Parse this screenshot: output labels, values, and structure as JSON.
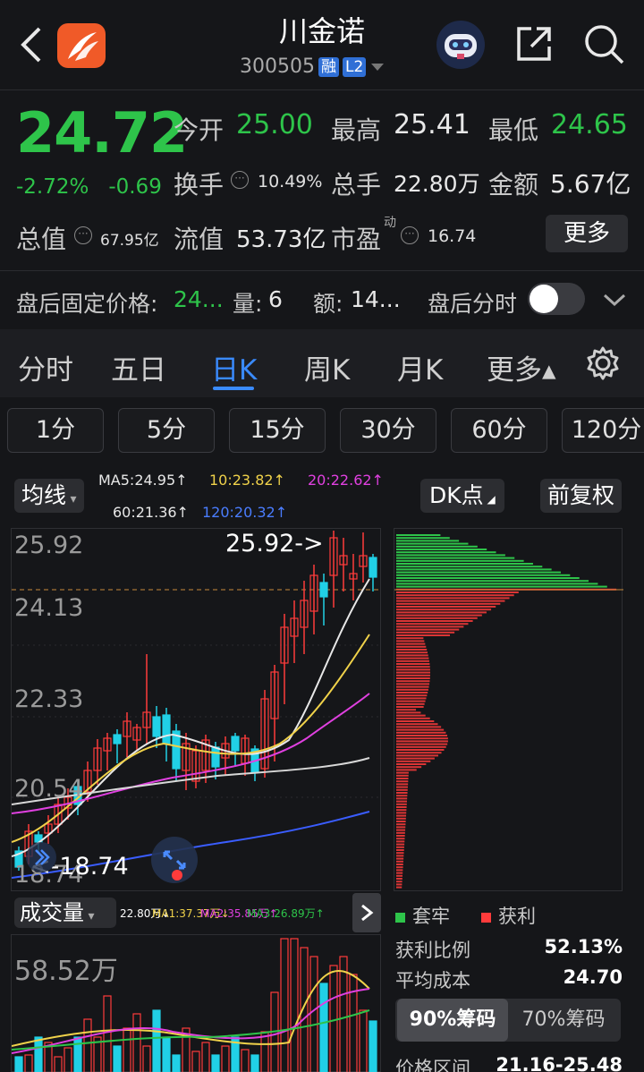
{
  "header": {
    "title": "川金诺",
    "code": "300505",
    "tag_margin": "融",
    "tag_level": "L2"
  },
  "quote": {
    "price": "24.72",
    "change_pct": "-2.72%",
    "change_amt": "-0.69",
    "open_label": "今开",
    "open": "25.00",
    "high_label": "最高",
    "high": "25.41",
    "low_label": "最低",
    "low": "24.65",
    "turnover_label": "换手",
    "turnover": "10.49%",
    "volume_label": "总手",
    "volume": "22.80万",
    "amount_label": "金额",
    "amount": "5.67亿",
    "mktcap_label": "总值",
    "mktcap": "67.95亿",
    "float_label": "流值",
    "float": "53.73亿",
    "pe_label": "市盈",
    "pe_sup": "动",
    "pe": "16.74",
    "more_label": "更多"
  },
  "after_hours": {
    "price_label": "盘后固定价格:",
    "price": "24...",
    "vol_label": "量:",
    "vol": "6",
    "amt_label": "额:",
    "amt": "14...",
    "timeshare_label": "盘后分时"
  },
  "tabs": [
    "分时",
    "五日",
    "日K",
    "周K",
    "月K",
    "更多▴"
  ],
  "periods": [
    "1分",
    "5分",
    "15分",
    "30分",
    "60分",
    "120分"
  ],
  "indicator": {
    "ma_btn": "均线",
    "ma5": "MA5:24.95↑",
    "ma10": "10:23.82↑",
    "ma20": "20:22.62↑",
    "ma60": "60:21.36↑",
    "ma120": "120:20.32↑",
    "dk_btn": "DK点",
    "adj_btn": "前复权"
  },
  "kline_axis": [
    "25.92",
    "24.13",
    "22.33",
    "20.54",
    "18.74"
  ],
  "kline_marks": {
    "high": "25.92->",
    "low": "<-18.74"
  },
  "volume": {
    "btn": "成交量",
    "v": "22.80万↓",
    "ma1": "MA1:37.37万↓",
    "ma2": "MA2:35.85万↑",
    "ma3": "MA3:26.89万↑",
    "axis": "58.52万"
  },
  "chips": {
    "legend_trapped": "套牢",
    "legend_profit": "获利",
    "profit_ratio_label": "获利比例",
    "profit_ratio": "52.13%",
    "avg_cost_label": "平均成本",
    "avg_cost": "24.70",
    "tab_90": "90%筹码",
    "tab_70": "70%筹码",
    "range_label": "价格区间",
    "range": "21.16-25.48"
  },
  "colors": {
    "up": "#ff3b3b",
    "down": "#2ec44a",
    "accent": "#3a8bff"
  }
}
